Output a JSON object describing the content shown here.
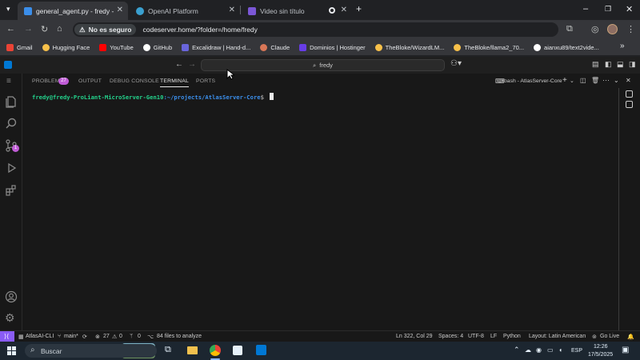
{
  "browser": {
    "tabs": [
      {
        "title": "general_agent.py - fredy - code",
        "active": true,
        "favicon_color": "#3b8eea"
      },
      {
        "title": "OpenAI Platform",
        "active": false,
        "favicon_color": "#3aa0d0"
      },
      {
        "title": "Video sin título",
        "active": false,
        "favicon_color": "#7b57d6"
      }
    ],
    "insecure_label": "No es seguro",
    "url": "codeserver.home/?folder=/home/fredy",
    "bookmarks": [
      {
        "label": "Gmail",
        "color": "#ea4335"
      },
      {
        "label": "Hugging Face",
        "color": "#f8c14a"
      },
      {
        "label": "YouTube",
        "color": "#ff0000"
      },
      {
        "label": "GitHub",
        "color": "#ffffff"
      },
      {
        "label": "Excalidraw | Hand-d...",
        "color": "#6965db"
      },
      {
        "label": "Claude",
        "color": "#d97757"
      },
      {
        "label": "Dominios | Hostinger",
        "color": "#673de6"
      },
      {
        "label": "TheBloke/WizardLM...",
        "color": "#f8c14a"
      },
      {
        "label": "TheBloke/llama2_70...",
        "color": "#f8c14a"
      },
      {
        "label": "aianxu89/text2vide...",
        "color": "#ffffff"
      }
    ]
  },
  "vscode": {
    "command_center": "fredy",
    "panel_tabs": [
      "PROBLEMS",
      "OUTPUT",
      "DEBUG CONSOLE",
      "TERMINAL",
      "PORTS"
    ],
    "problems_badge": "27",
    "active_panel_tab": "TERMINAL",
    "terminal_name": "bash - AtlasServer-Core",
    "prompt_user": "fredy@fredy-ProLiant-MicroServer-Gen10",
    "prompt_path": ":~/projects/AtlasServer-Core",
    "prompt_symbol": "$",
    "activity_badge": "1",
    "status": {
      "project": "AtlasAI-CLI",
      "branch": "main*",
      "errors": "27",
      "warnings": "0",
      "ports": "0",
      "analyze": "84 files to analyze",
      "position": "Ln 322, Col 29",
      "spaces": "Spaces: 4",
      "encoding": "UTF-8",
      "eol": "LF",
      "language": "Python",
      "layout": "Layout: Latin American",
      "golive": "Go Live"
    }
  },
  "taskbar": {
    "search_placeholder": "Buscar",
    "language": "ESP",
    "time": "12:26",
    "date": "17/5/2025"
  },
  "colors": {
    "accent": "#0078d4",
    "prompt_green": "#23d18b",
    "remote_purple": "#8a5cf5"
  }
}
